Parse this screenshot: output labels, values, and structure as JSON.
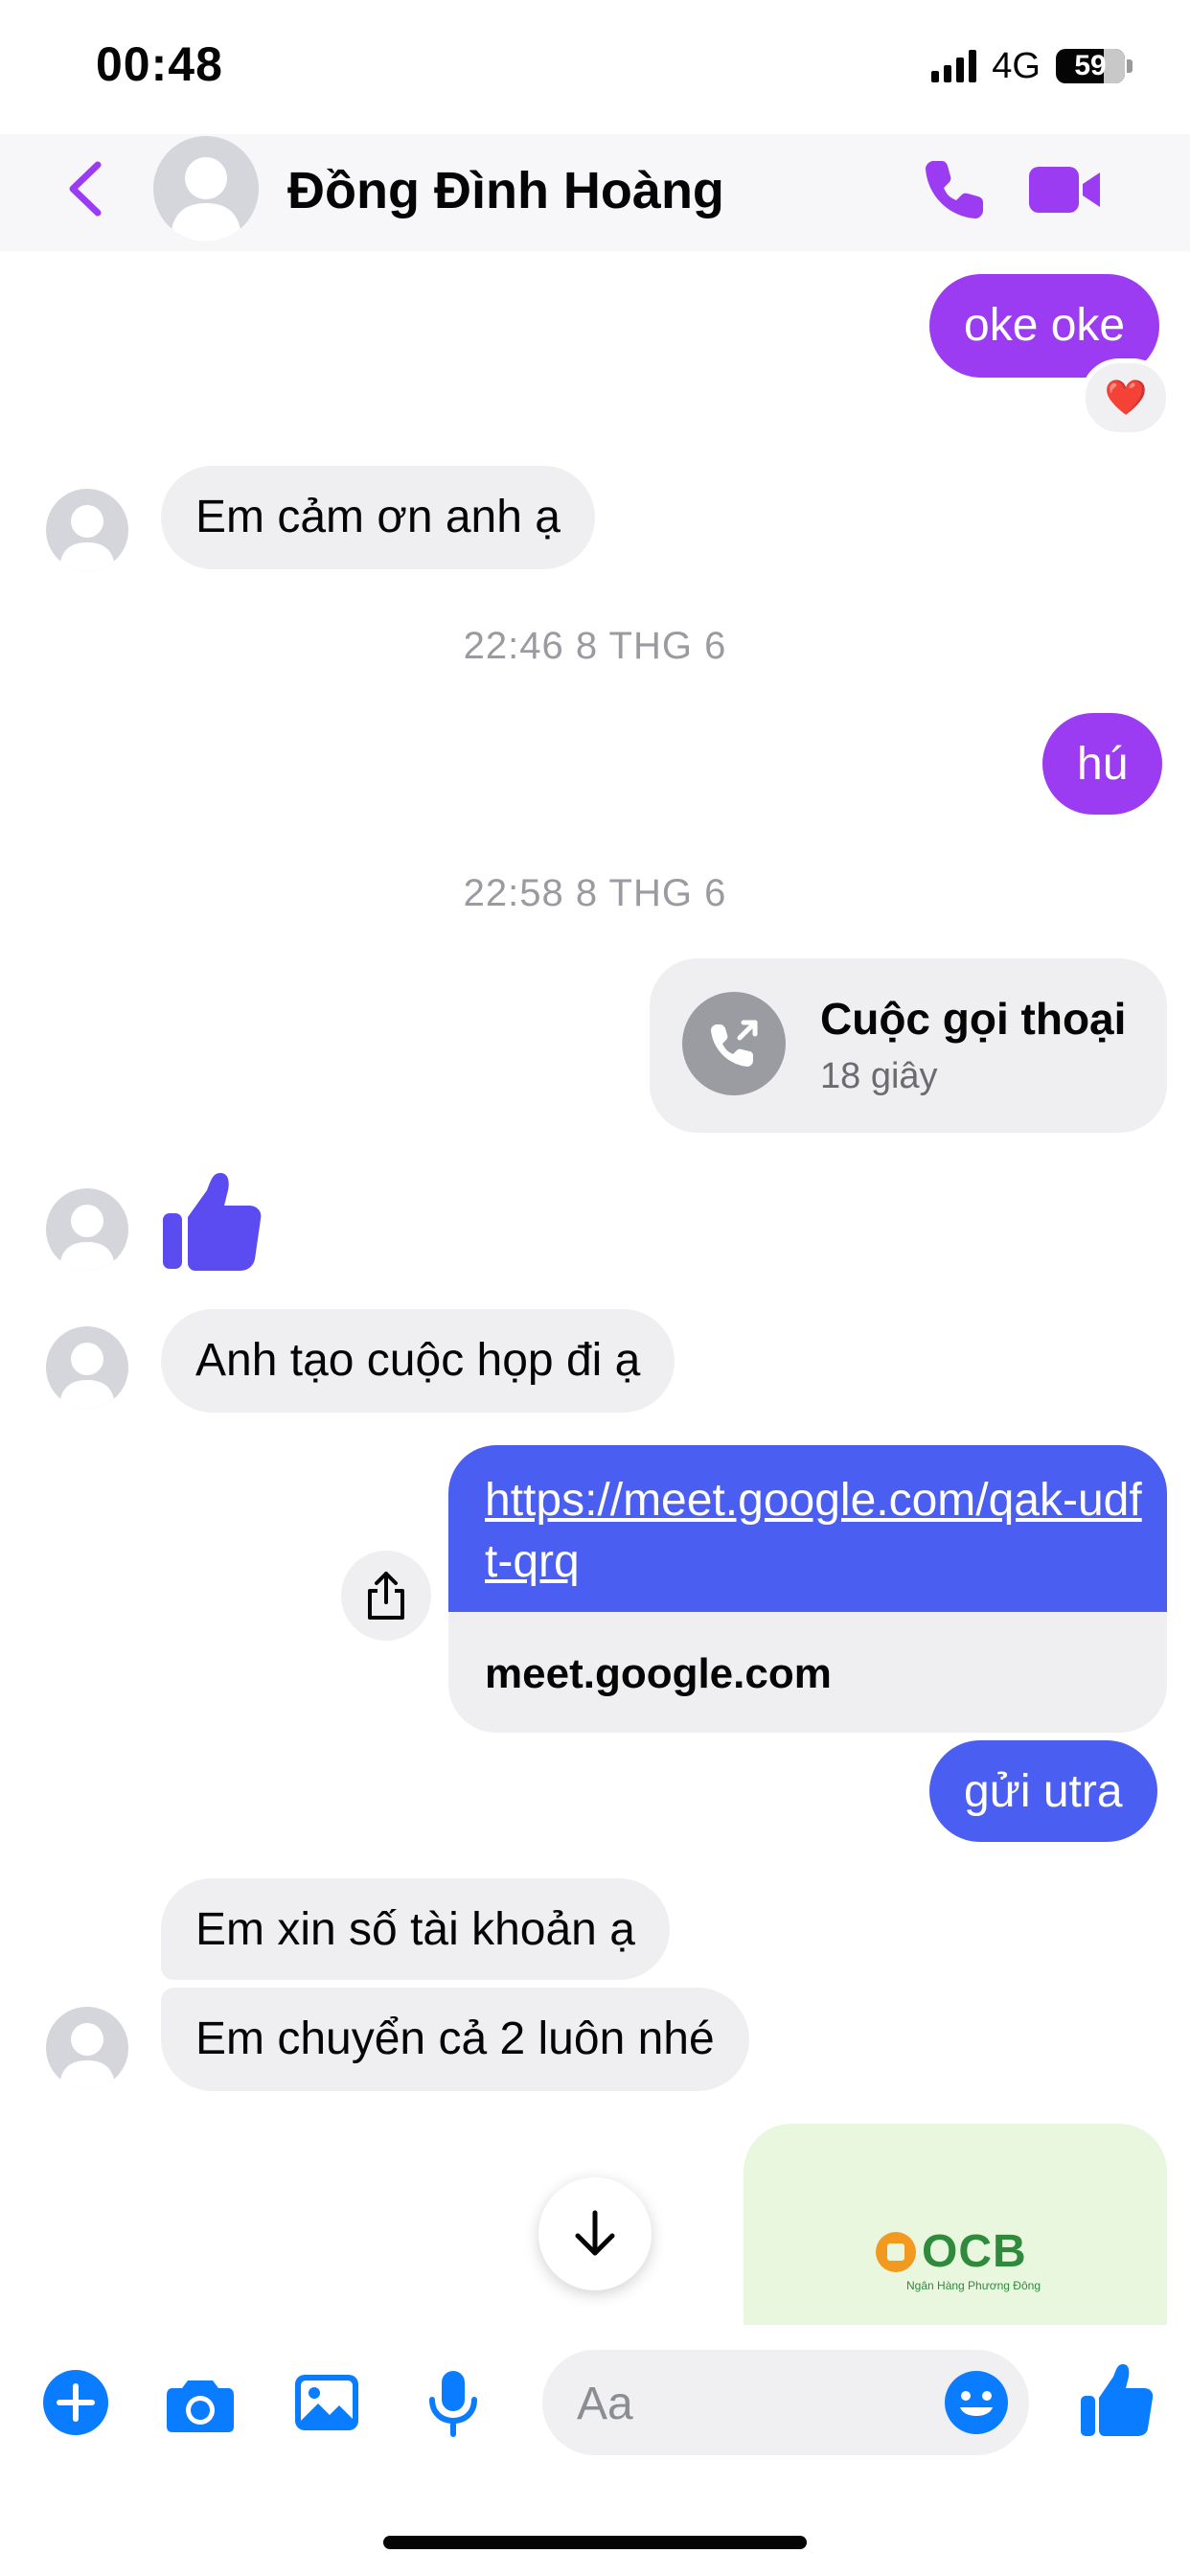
{
  "status_bar": {
    "time": "00:48",
    "network": "4G",
    "battery": "59"
  },
  "header": {
    "contact_name": "Đồng Đình Hoàng"
  },
  "messages": {
    "m1": "oke oke",
    "m1_reaction": "❤️",
    "m2": "Em cảm ơn anh ạ",
    "ts1": "22:46 8 THG 6",
    "m3": "hú",
    "ts2": "22:58 8 THG 6",
    "call_title": "Cuộc gọi thoại",
    "call_duration": "18 giây",
    "m5": "Anh tạo cuộc họp đi ạ",
    "link_url": "https://meet.google.com/qak-udft-qrq",
    "link_domain": "meet.google.com",
    "m7": "gửi utra",
    "m8": "Em xin số tài khoản ạ",
    "m9": "Em chuyển cả 2 luôn nhé",
    "image_logo": "OCB",
    "image_logo_sub": "Ngân Hàng Phương Đông"
  },
  "composer": {
    "placeholder": "Aa"
  },
  "colors": {
    "accent_purple": "#9b3cf2",
    "accent_blue": "#4a5ff2",
    "messenger_blue": "#0a7cff"
  }
}
